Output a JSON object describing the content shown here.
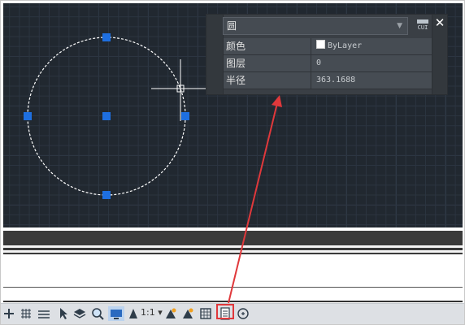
{
  "properties_palette": {
    "object_type": "圆",
    "cui_label": "CUI",
    "close_glyph": "✕",
    "rows": [
      {
        "key": "颜色",
        "value": "ByLayer",
        "has_swatch": true
      },
      {
        "key": "图层",
        "value": "0",
        "has_swatch": false
      },
      {
        "key": "半径",
        "value": "363.1688",
        "has_swatch": false
      }
    ]
  },
  "status_bar": {
    "annotation_scale": "1:1",
    "icons": [
      "snap-icon",
      "grid-icon",
      "lineweight-icon",
      "selection-icon",
      "layers-icon",
      "zoom-icon",
      "monitor-icon",
      "annotation-scale-icon",
      "annotation-visibility-icon",
      "autoscale-icon",
      "isolate-icon",
      "properties-palette-icon",
      "clean-screen-icon"
    ]
  },
  "colors": {
    "canvas_bg": "#212830",
    "grip": "#1e6fe0",
    "highlight": "#e0383b"
  }
}
